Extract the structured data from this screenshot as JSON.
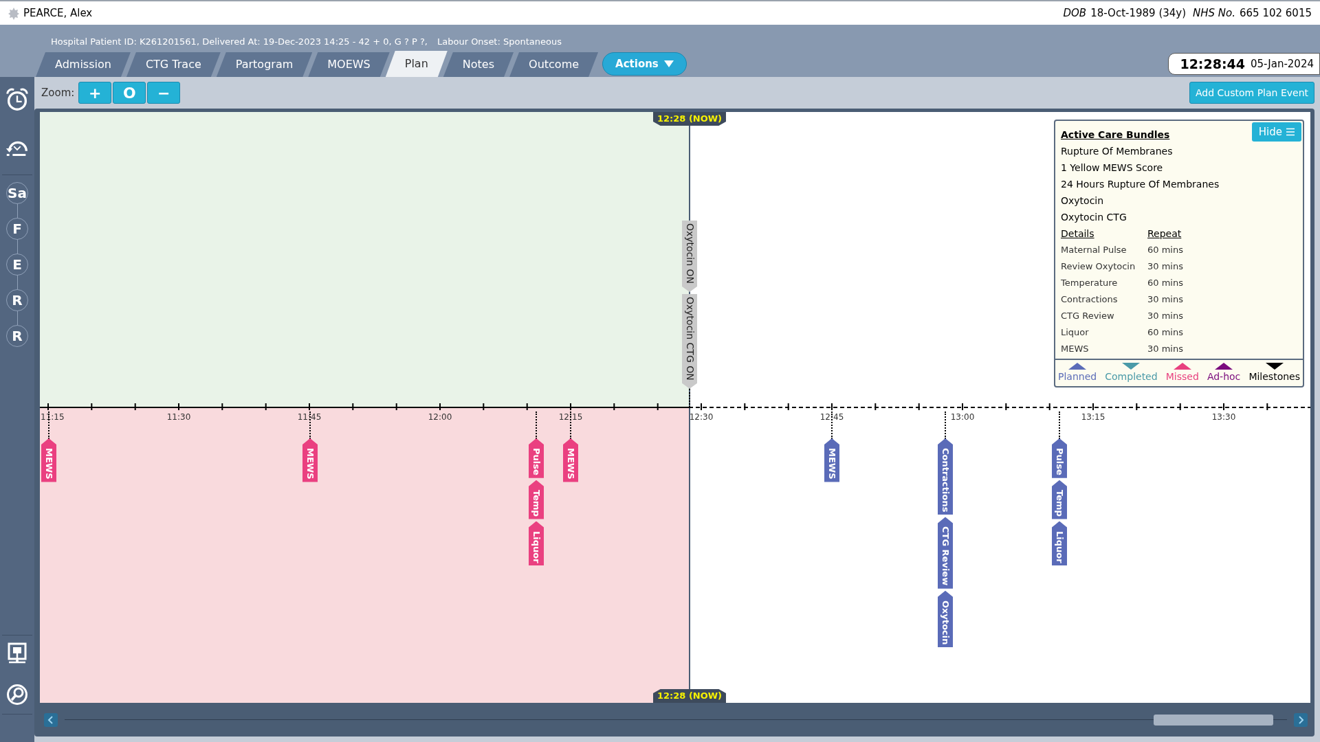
{
  "patient": {
    "name": "PEARCE, Alex",
    "dob_label": "DOB",
    "dob": "18-Oct-1989 (34y)",
    "nhs_label": "NHS No.",
    "nhs": "665 102 6015"
  },
  "info": {
    "delivery": "Hospital Patient ID: K261201561, Delivered At: 19-Dec-2023 14:25 - 42 + 0, G ? P ?,",
    "onset": "Labour Onset: Spontaneous"
  },
  "tabs": [
    {
      "label": "Admission",
      "selected": false
    },
    {
      "label": "CTG Trace",
      "selected": false
    },
    {
      "label": "Partogram",
      "selected": false
    },
    {
      "label": "MOEWS",
      "selected": false
    },
    {
      "label": "Plan",
      "selected": true
    },
    {
      "label": "Notes",
      "selected": false
    },
    {
      "label": "Outcome",
      "selected": false
    }
  ],
  "actions_button": "Actions",
  "clock": {
    "time": "12:28:44",
    "date": "05-Jan-2024"
  },
  "toolbar": {
    "zoom_label": "Zoom:",
    "zoom_buttons": [
      "+",
      "O",
      "−"
    ],
    "add_button": "Add Custom Plan Event"
  },
  "sidebar": {
    "stages": [
      "Sa",
      "F",
      "E",
      "R",
      "R"
    ]
  },
  "timeline": {
    "now_labels": [
      "12:28 (NOW)",
      "12:28 (NOW)"
    ],
    "ticks": [
      "11:15",
      "11:30",
      "11:45",
      "12:00",
      "12:15",
      "12:30",
      "12:45",
      "13:00",
      "13:15",
      "13:30"
    ],
    "milestones": [
      {
        "label": "Oxytocin ON"
      },
      {
        "label": "Oxytocin CTG ON"
      }
    ],
    "events": [
      {
        "missed": true,
        "labels": [
          "MEWS"
        ]
      },
      {
        "missed": true,
        "labels": [
          "MEWS"
        ]
      },
      {
        "missed": true,
        "labels": [
          "Pulse",
          "Temp",
          "Liquor"
        ]
      },
      {
        "missed": true,
        "labels": [
          "MEWS"
        ]
      },
      {
        "missed": false,
        "labels": [
          "MEWS"
        ]
      },
      {
        "missed": false,
        "labels": [
          "Contractions",
          "CTG Review",
          "Oxytocin"
        ]
      },
      {
        "missed": false,
        "labels": [
          "Pulse",
          "Temp",
          "Liquor"
        ]
      }
    ]
  },
  "care_bundles": {
    "title": "Active Care Bundles",
    "hide_button": "Hide",
    "bundles": [
      "Rupture Of Membranes",
      "1 Yellow MEWS Score",
      "24 Hours Rupture Of Membranes",
      "Oxytocin",
      "Oxytocin CTG"
    ],
    "columns": [
      "Details",
      "Repeat"
    ],
    "details": [
      {
        "detail": "Maternal Pulse",
        "repeat": "60 mins"
      },
      {
        "detail": "Review Oxytocin",
        "repeat": "30 mins"
      },
      {
        "detail": "Temperature",
        "repeat": "60 mins"
      },
      {
        "detail": "Contractions",
        "repeat": "30 mins"
      },
      {
        "detail": "CTG Review",
        "repeat": "30 mins"
      },
      {
        "detail": "Liquor",
        "repeat": "60 mins"
      },
      {
        "detail": "MEWS",
        "repeat": "30 mins"
      }
    ],
    "legend": [
      {
        "label": "Planned",
        "color": "#5b6cb8",
        "points_down": false
      },
      {
        "label": "Completed",
        "color": "#4a9aa8",
        "points_down": true
      },
      {
        "label": "Missed",
        "color": "#e8407f",
        "points_down": false
      },
      {
        "label": "Ad-hoc",
        "color": "#7a0b7d",
        "points_down": false
      },
      {
        "label": "Milestones",
        "color": "#000000",
        "points_down": true
      }
    ]
  }
}
